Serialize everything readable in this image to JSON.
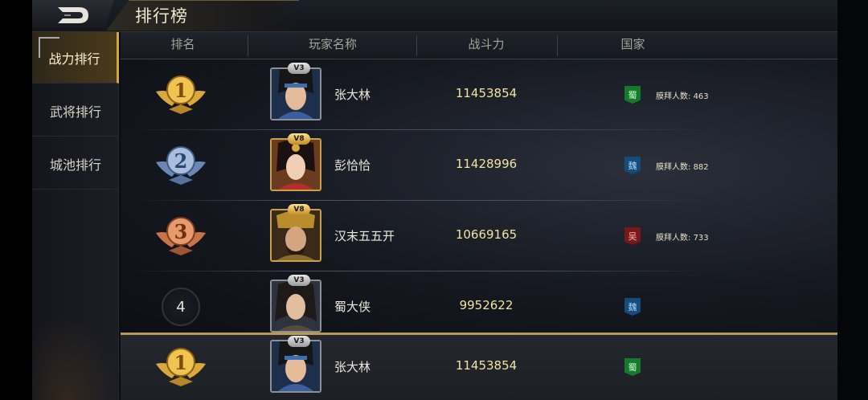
{
  "header": {
    "title": "排行榜"
  },
  "sidebar": {
    "items": [
      {
        "label": "战力排行",
        "active": true
      },
      {
        "label": "武将排行",
        "active": false
      },
      {
        "label": "城池排行",
        "active": false
      }
    ]
  },
  "table": {
    "columns": [
      "排名",
      "玩家名称",
      "战斗力",
      "国家"
    ],
    "rows": [
      {
        "rank": "1",
        "vip": "V3",
        "name": "张大林",
        "power": "11453854",
        "nation": "蜀",
        "worship_label": "膜拜人数:",
        "worship_count": "463"
      },
      {
        "rank": "2",
        "vip": "V8",
        "name": "彭恰恰",
        "power": "11428996",
        "nation": "魏",
        "worship_label": "膜拜人数:",
        "worship_count": "882"
      },
      {
        "rank": "3",
        "vip": "V8",
        "name": "汉末五五开",
        "power": "10669165",
        "nation": "吴",
        "worship_label": "膜拜人数:",
        "worship_count": "733"
      },
      {
        "rank": "4",
        "vip": "V3",
        "name": "蜀大侠",
        "power": "9952622",
        "nation": "魏"
      }
    ]
  },
  "my_rank": {
    "rank": "1",
    "vip": "V3",
    "name": "张大林",
    "power": "11453854",
    "nation": "蜀"
  },
  "colors": {
    "accent_gold": "#d2a646",
    "power_text": "#f3e3a0",
    "shu": "#167a2c",
    "wei": "#174b7a",
    "wu": "#7a1718"
  },
  "icons": {
    "back": "back-arrow-icon",
    "medal_gold": "gold-medal-icon",
    "medal_silver": "silver-medal-icon",
    "medal_bronze": "bronze-medal-icon"
  }
}
